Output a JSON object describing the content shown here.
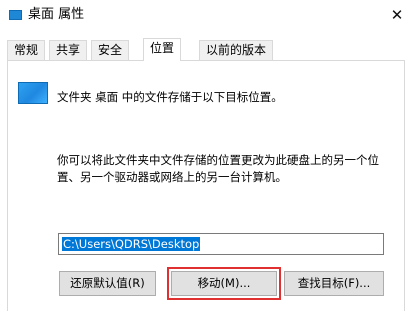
{
  "window": {
    "title": "桌面 属性",
    "close_glyph": "✕"
  },
  "tabs": [
    {
      "label": "常规",
      "active": false
    },
    {
      "label": "共享",
      "active": false
    },
    {
      "label": "安全",
      "active": false
    },
    {
      "label": "位置",
      "active": true
    },
    {
      "label": "以前的版本",
      "active": false
    }
  ],
  "location": {
    "header_text": "文件夹 桌面 中的文件存储于以下目标位置。",
    "description": "你可以将此文件夹中文件存储的位置更改为此硬盘上的另一个位置、另一个驱动器或网络上的另一台计算机。",
    "path_value": "C:\\Users\\QDRS\\Desktop"
  },
  "buttons": {
    "restore": "还原默认值(R)",
    "move": "移动(M)...",
    "find_target": "查找目标(F)..."
  },
  "colors": {
    "accent": "#0078d7",
    "highlight_box": "#e03030",
    "folder_icon": "#1e88d6"
  },
  "icons": {
    "window_icon": "folder-icon",
    "location_icon": "folder-icon"
  }
}
